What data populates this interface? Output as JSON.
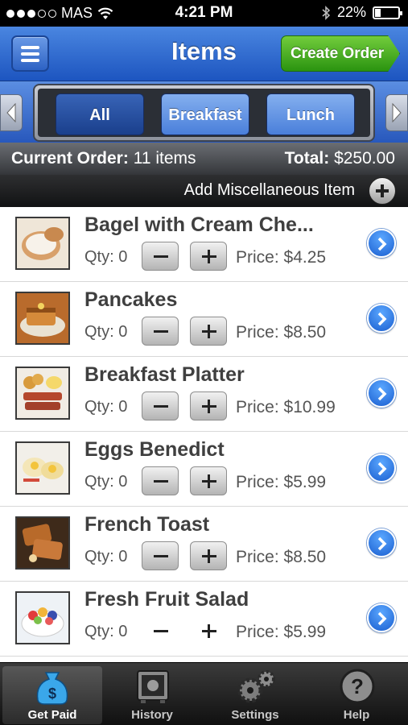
{
  "status_bar": {
    "carrier": "MAS",
    "time": "4:21 PM",
    "battery": "22%"
  },
  "header": {
    "title": "Items",
    "create_order_label": "Create Order"
  },
  "categories": [
    {
      "label": "All",
      "active": true
    },
    {
      "label": "Breakfast",
      "active": false
    },
    {
      "label": "Lunch",
      "active": false
    }
  ],
  "order_summary": {
    "current_order_label": "Current Order:",
    "current_order_value": "11 items",
    "total_label": "Total:",
    "total_value": "$250.00"
  },
  "misc_item_label": "Add Miscellaneous Item",
  "items": [
    {
      "name": "Bagel with Cream Che...",
      "qty_label": "Qty: 0",
      "price_label": "Price: $4.25",
      "icon": "bagel-thumbnail"
    },
    {
      "name": "Pancakes",
      "qty_label": "Qty: 0",
      "price_label": "Price: $8.50",
      "icon": "pancakes-thumbnail"
    },
    {
      "name": "Breakfast Platter",
      "qty_label": "Qty: 0",
      "price_label": "Price: $10.99",
      "icon": "breakfast-platter-thumbnail"
    },
    {
      "name": "Eggs Benedict",
      "qty_label": "Qty: 0",
      "price_label": "Price: $5.99",
      "icon": "eggs-benedict-thumbnail"
    },
    {
      "name": "French Toast",
      "qty_label": "Qty: 0",
      "price_label": "Price: $8.50",
      "icon": "french-toast-thumbnail"
    },
    {
      "name": "Fresh Fruit Salad",
      "qty_label": "Qty: 0",
      "price_label": "Price: $5.99",
      "icon": "fruit-salad-thumbnail"
    }
  ],
  "tab_bar": [
    {
      "label": "Get Paid",
      "icon": "money-bag-icon",
      "active": true
    },
    {
      "label": "History",
      "icon": "safe-icon",
      "active": false
    },
    {
      "label": "Settings",
      "icon": "gears-icon",
      "active": false
    },
    {
      "label": "Help",
      "icon": "help-icon",
      "active": false
    }
  ],
  "colors": {
    "nav_blue": "#1d55c0",
    "create_green": "#2b9410",
    "detail_blue": "#1b5fd0"
  }
}
